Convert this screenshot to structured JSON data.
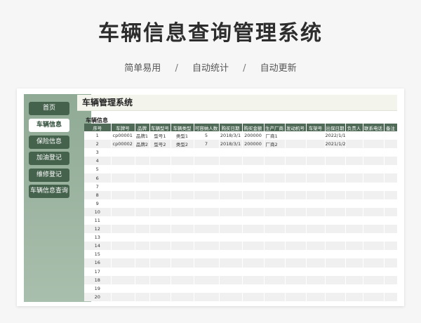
{
  "header": {
    "title": "车辆信息查询管理系统",
    "features": [
      "简单易用",
      "自动统计",
      "自动更新"
    ],
    "separator": "/"
  },
  "sidebar": {
    "items": [
      {
        "label": "首页",
        "active": false
      },
      {
        "label": "车辆信息",
        "active": true
      },
      {
        "label": "保险信息",
        "active": false
      },
      {
        "label": "加油登记",
        "active": false
      },
      {
        "label": "维修登记",
        "active": false
      },
      {
        "label": "车辆信息查询",
        "active": false
      }
    ]
  },
  "main": {
    "title": "车辆管理系统",
    "section_title": "车辆信息",
    "columns": [
      "序号",
      "车牌号",
      "品牌",
      "车辆型号",
      "车辆类型",
      "可容纳人数",
      "购买日期",
      "购买金额",
      "生产厂商",
      "发动机号",
      "车架号",
      "出保日期",
      "负责人",
      "联系电话",
      "备注"
    ],
    "rows": [
      [
        "1",
        "cp00001",
        "品牌1",
        "型号1",
        "类型1",
        "5",
        "2018/3/1",
        "200000",
        "厂商1",
        "",
        "",
        "2022/1/1",
        "",
        "",
        ""
      ],
      [
        "2",
        "cp00002",
        "品牌2",
        "型号2",
        "类型2",
        "7",
        "2018/3/1",
        "200000",
        "厂商2",
        "",
        "",
        "2021/1/2",
        "",
        "",
        ""
      ],
      [
        "3",
        "",
        "",
        "",
        "",
        "",
        "",
        "",
        "",
        "",
        "",
        "",
        "",
        "",
        ""
      ],
      [
        "4",
        "",
        "",
        "",
        "",
        "",
        "",
        "",
        "",
        "",
        "",
        "",
        "",
        "",
        ""
      ],
      [
        "5",
        "",
        "",
        "",
        "",
        "",
        "",
        "",
        "",
        "",
        "",
        "",
        "",
        "",
        ""
      ],
      [
        "6",
        "",
        "",
        "",
        "",
        "",
        "",
        "",
        "",
        "",
        "",
        "",
        "",
        "",
        ""
      ],
      [
        "7",
        "",
        "",
        "",
        "",
        "",
        "",
        "",
        "",
        "",
        "",
        "",
        "",
        "",
        ""
      ],
      [
        "8",
        "",
        "",
        "",
        "",
        "",
        "",
        "",
        "",
        "",
        "",
        "",
        "",
        "",
        ""
      ],
      [
        "9",
        "",
        "",
        "",
        "",
        "",
        "",
        "",
        "",
        "",
        "",
        "",
        "",
        "",
        ""
      ],
      [
        "10",
        "",
        "",
        "",
        "",
        "",
        "",
        "",
        "",
        "",
        "",
        "",
        "",
        "",
        ""
      ],
      [
        "11",
        "",
        "",
        "",
        "",
        "",
        "",
        "",
        "",
        "",
        "",
        "",
        "",
        "",
        ""
      ],
      [
        "12",
        "",
        "",
        "",
        "",
        "",
        "",
        "",
        "",
        "",
        "",
        "",
        "",
        "",
        ""
      ],
      [
        "13",
        "",
        "",
        "",
        "",
        "",
        "",
        "",
        "",
        "",
        "",
        "",
        "",
        "",
        ""
      ],
      [
        "14",
        "",
        "",
        "",
        "",
        "",
        "",
        "",
        "",
        "",
        "",
        "",
        "",
        "",
        ""
      ],
      [
        "15",
        "",
        "",
        "",
        "",
        "",
        "",
        "",
        "",
        "",
        "",
        "",
        "",
        "",
        ""
      ],
      [
        "16",
        "",
        "",
        "",
        "",
        "",
        "",
        "",
        "",
        "",
        "",
        "",
        "",
        "",
        ""
      ],
      [
        "17",
        "",
        "",
        "",
        "",
        "",
        "",
        "",
        "",
        "",
        "",
        "",
        "",
        "",
        ""
      ],
      [
        "18",
        "",
        "",
        "",
        "",
        "",
        "",
        "",
        "",
        "",
        "",
        "",
        "",
        "",
        ""
      ],
      [
        "19",
        "",
        "",
        "",
        "",
        "",
        "",
        "",
        "",
        "",
        "",
        "",
        "",
        "",
        ""
      ],
      [
        "20",
        "",
        "",
        "",
        "",
        "",
        "",
        "",
        "",
        "",
        "",
        "",
        "",
        "",
        ""
      ]
    ]
  },
  "colors": {
    "sidebar_button": "#45624d",
    "table_header": "#4f6b57",
    "accent_bg": "#f3f5ec"
  }
}
